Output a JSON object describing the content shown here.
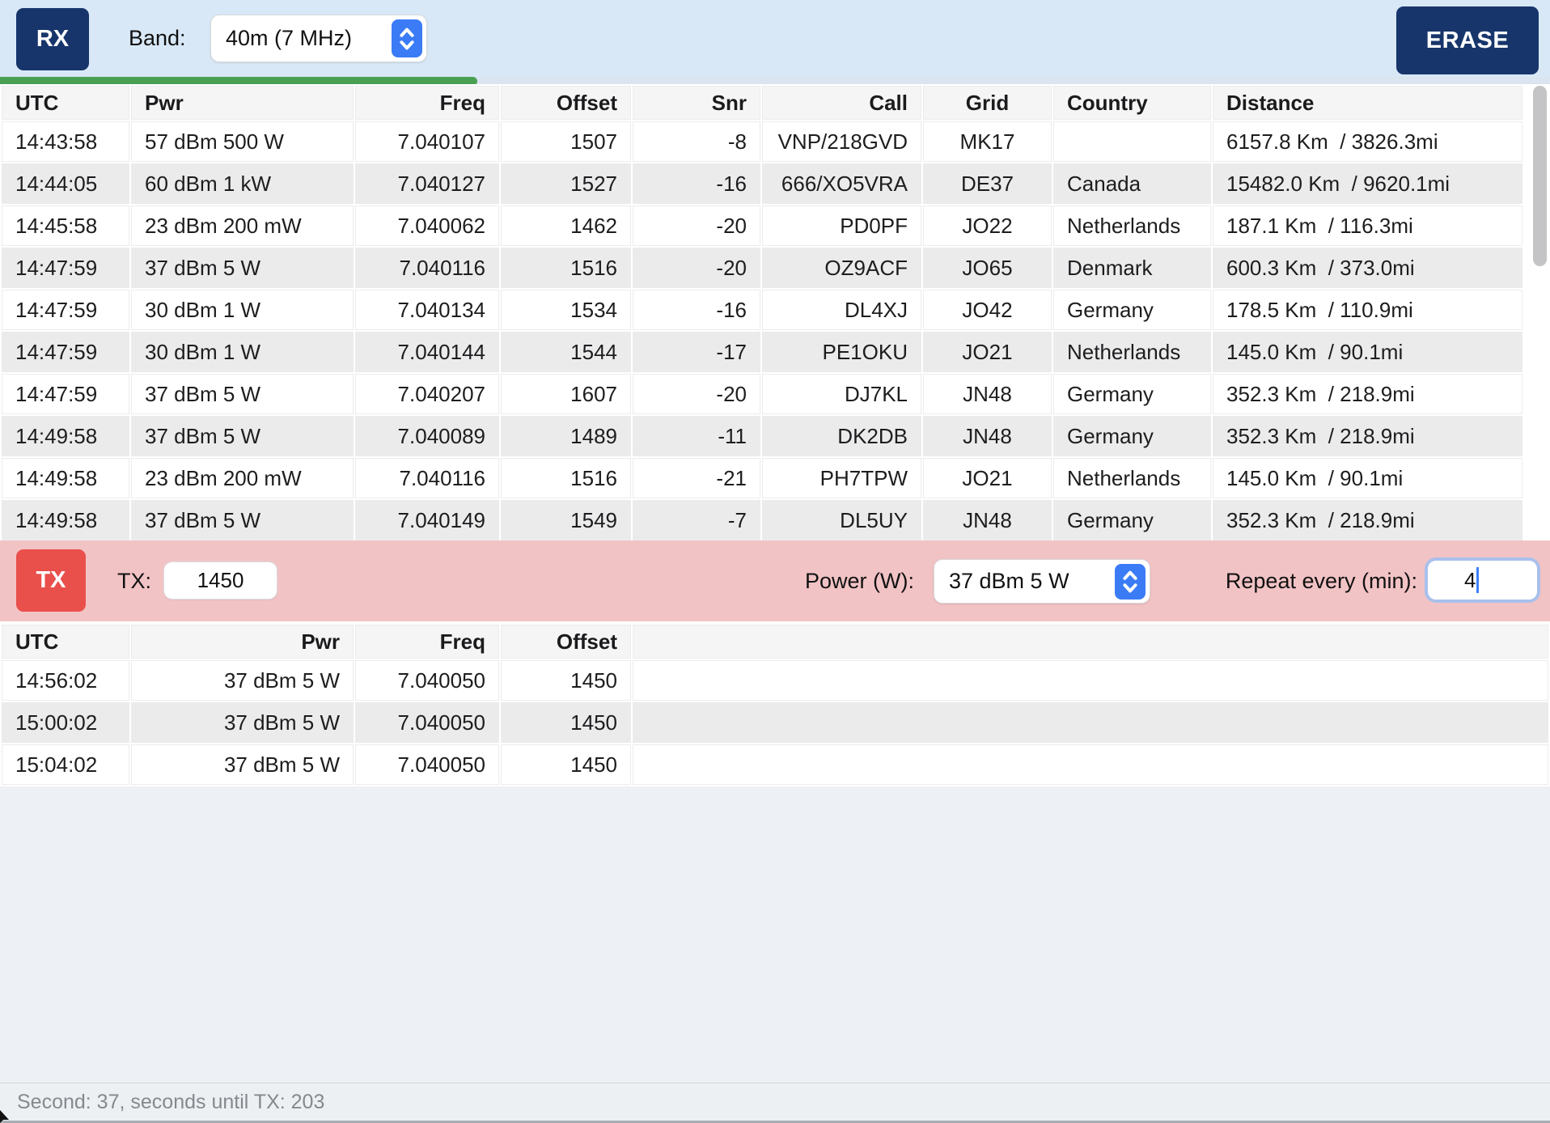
{
  "topbar": {
    "rx_label": "RX",
    "band_label": "Band:",
    "band_value": "40m (7 MHz)",
    "erase_label": "ERASE",
    "progress_percent": 30.8
  },
  "rx_table": {
    "headers": [
      "UTC",
      "Pwr",
      "Freq",
      "Offset",
      "Snr",
      "Call",
      "Grid",
      "Country",
      "Distance"
    ],
    "rows": [
      [
        "14:43:58",
        "57 dBm 500 W",
        "7.040107",
        "1507",
        "-8",
        "VNP/218GVD",
        "MK17",
        "",
        "6157.8 Km  / 3826.3mi"
      ],
      [
        "14:44:05",
        "60 dBm 1 kW",
        "7.040127",
        "1527",
        "-16",
        "666/XO5VRA",
        "DE37",
        "Canada",
        "15482.0 Km  / 9620.1mi"
      ],
      [
        "14:45:58",
        "23 dBm 200 mW",
        "7.040062",
        "1462",
        "-20",
        "PD0PF",
        "JO22",
        "Netherlands",
        "187.1 Km  / 116.3mi"
      ],
      [
        "14:47:59",
        "37 dBm 5 W",
        "7.040116",
        "1516",
        "-20",
        "OZ9ACF",
        "JO65",
        "Denmark",
        "600.3 Km  / 373.0mi"
      ],
      [
        "14:47:59",
        "30 dBm 1 W",
        "7.040134",
        "1534",
        "-16",
        "DL4XJ",
        "JO42",
        "Germany",
        "178.5 Km  / 110.9mi"
      ],
      [
        "14:47:59",
        "30 dBm 1 W",
        "7.040144",
        "1544",
        "-17",
        "PE1OKU",
        "JO21",
        "Netherlands",
        "145.0 Km  / 90.1mi"
      ],
      [
        "14:47:59",
        "37 dBm 5 W",
        "7.040207",
        "1607",
        "-20",
        "DJ7KL",
        "JN48",
        "Germany",
        "352.3 Km  / 218.9mi"
      ],
      [
        "14:49:58",
        "37 dBm 5 W",
        "7.040089",
        "1489",
        "-11",
        "DK2DB",
        "JN48",
        "Germany",
        "352.3 Km  / 218.9mi"
      ],
      [
        "14:49:58",
        "23 dBm 200 mW",
        "7.040116",
        "1516",
        "-21",
        "PH7TPW",
        "JO21",
        "Netherlands",
        "145.0 Km  / 90.1mi"
      ],
      [
        "14:49:58",
        "37 dBm 5 W",
        "7.040149",
        "1549",
        "-7",
        "DL5UY",
        "JN48",
        "Germany",
        "352.3 Km  / 218.9mi"
      ]
    ]
  },
  "tx_bar": {
    "tx_label": "TX",
    "tx_field_label": "TX:",
    "tx_offset_value": "1450",
    "power_label": "Power (W):",
    "power_value": "37 dBm 5 W",
    "repeat_label": "Repeat every (min):",
    "repeat_value": "4"
  },
  "tx_table": {
    "headers": [
      "UTC",
      "Pwr",
      "Freq",
      "Offset",
      ""
    ],
    "rows": [
      [
        "14:56:02",
        "37 dBm 5 W",
        "7.040050",
        "1450",
        ""
      ],
      [
        "15:00:02",
        "37 dBm 5 W",
        "7.040050",
        "1450",
        ""
      ],
      [
        "15:04:02",
        "37 dBm 5 W",
        "7.040050",
        "1450",
        ""
      ]
    ]
  },
  "status_bar": {
    "text": "Second: 37, seconds until TX: 203"
  },
  "colors": {
    "navy_button": "#17356b",
    "topbar_background": "#d8e8f7",
    "progress_green": "#4aa052",
    "tx_bar_pink": "#f2c3c5",
    "tx_button_red": "#e94f4b",
    "stepper_blue": "#3b7cf6",
    "focus_ring": "#a9c0ec",
    "row_stripe_gray": "#ebebec"
  }
}
